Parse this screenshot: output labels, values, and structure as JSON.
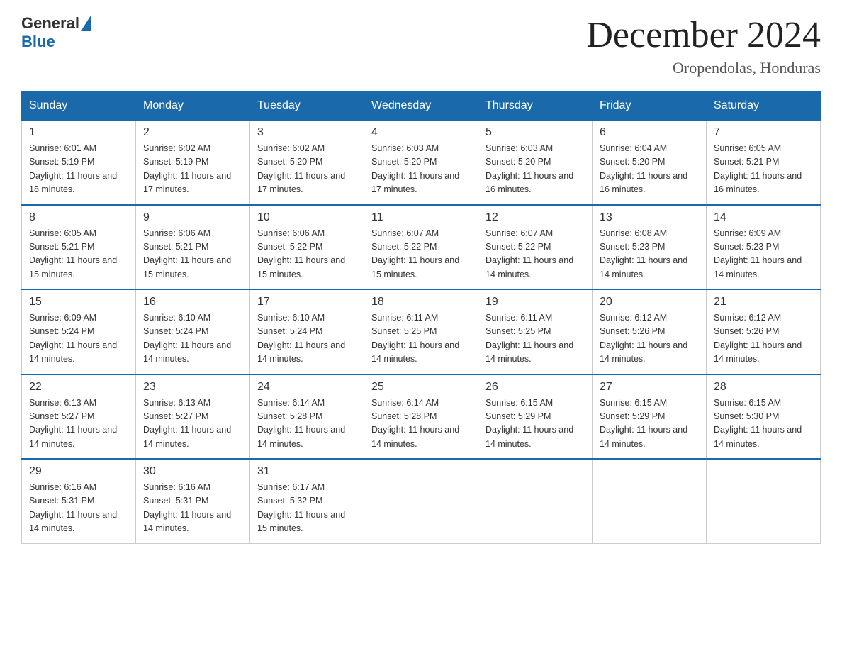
{
  "logo": {
    "text1": "General",
    "text2": "Blue"
  },
  "title": "December 2024",
  "location": "Oropendolas, Honduras",
  "days_header": [
    "Sunday",
    "Monday",
    "Tuesday",
    "Wednesday",
    "Thursday",
    "Friday",
    "Saturday"
  ],
  "weeks": [
    [
      {
        "day": "1",
        "sunrise": "6:01 AM",
        "sunset": "5:19 PM",
        "daylight": "11 hours and 18 minutes."
      },
      {
        "day": "2",
        "sunrise": "6:02 AM",
        "sunset": "5:19 PM",
        "daylight": "11 hours and 17 minutes."
      },
      {
        "day": "3",
        "sunrise": "6:02 AM",
        "sunset": "5:20 PM",
        "daylight": "11 hours and 17 minutes."
      },
      {
        "day": "4",
        "sunrise": "6:03 AM",
        "sunset": "5:20 PM",
        "daylight": "11 hours and 17 minutes."
      },
      {
        "day": "5",
        "sunrise": "6:03 AM",
        "sunset": "5:20 PM",
        "daylight": "11 hours and 16 minutes."
      },
      {
        "day": "6",
        "sunrise": "6:04 AM",
        "sunset": "5:20 PM",
        "daylight": "11 hours and 16 minutes."
      },
      {
        "day": "7",
        "sunrise": "6:05 AM",
        "sunset": "5:21 PM",
        "daylight": "11 hours and 16 minutes."
      }
    ],
    [
      {
        "day": "8",
        "sunrise": "6:05 AM",
        "sunset": "5:21 PM",
        "daylight": "11 hours and 15 minutes."
      },
      {
        "day": "9",
        "sunrise": "6:06 AM",
        "sunset": "5:21 PM",
        "daylight": "11 hours and 15 minutes."
      },
      {
        "day": "10",
        "sunrise": "6:06 AM",
        "sunset": "5:22 PM",
        "daylight": "11 hours and 15 minutes."
      },
      {
        "day": "11",
        "sunrise": "6:07 AM",
        "sunset": "5:22 PM",
        "daylight": "11 hours and 15 minutes."
      },
      {
        "day": "12",
        "sunrise": "6:07 AM",
        "sunset": "5:22 PM",
        "daylight": "11 hours and 14 minutes."
      },
      {
        "day": "13",
        "sunrise": "6:08 AM",
        "sunset": "5:23 PM",
        "daylight": "11 hours and 14 minutes."
      },
      {
        "day": "14",
        "sunrise": "6:09 AM",
        "sunset": "5:23 PM",
        "daylight": "11 hours and 14 minutes."
      }
    ],
    [
      {
        "day": "15",
        "sunrise": "6:09 AM",
        "sunset": "5:24 PM",
        "daylight": "11 hours and 14 minutes."
      },
      {
        "day": "16",
        "sunrise": "6:10 AM",
        "sunset": "5:24 PM",
        "daylight": "11 hours and 14 minutes."
      },
      {
        "day": "17",
        "sunrise": "6:10 AM",
        "sunset": "5:24 PM",
        "daylight": "11 hours and 14 minutes."
      },
      {
        "day": "18",
        "sunrise": "6:11 AM",
        "sunset": "5:25 PM",
        "daylight": "11 hours and 14 minutes."
      },
      {
        "day": "19",
        "sunrise": "6:11 AM",
        "sunset": "5:25 PM",
        "daylight": "11 hours and 14 minutes."
      },
      {
        "day": "20",
        "sunrise": "6:12 AM",
        "sunset": "5:26 PM",
        "daylight": "11 hours and 14 minutes."
      },
      {
        "day": "21",
        "sunrise": "6:12 AM",
        "sunset": "5:26 PM",
        "daylight": "11 hours and 14 minutes."
      }
    ],
    [
      {
        "day": "22",
        "sunrise": "6:13 AM",
        "sunset": "5:27 PM",
        "daylight": "11 hours and 14 minutes."
      },
      {
        "day": "23",
        "sunrise": "6:13 AM",
        "sunset": "5:27 PM",
        "daylight": "11 hours and 14 minutes."
      },
      {
        "day": "24",
        "sunrise": "6:14 AM",
        "sunset": "5:28 PM",
        "daylight": "11 hours and 14 minutes."
      },
      {
        "day": "25",
        "sunrise": "6:14 AM",
        "sunset": "5:28 PM",
        "daylight": "11 hours and 14 minutes."
      },
      {
        "day": "26",
        "sunrise": "6:15 AM",
        "sunset": "5:29 PM",
        "daylight": "11 hours and 14 minutes."
      },
      {
        "day": "27",
        "sunrise": "6:15 AM",
        "sunset": "5:29 PM",
        "daylight": "11 hours and 14 minutes."
      },
      {
        "day": "28",
        "sunrise": "6:15 AM",
        "sunset": "5:30 PM",
        "daylight": "11 hours and 14 minutes."
      }
    ],
    [
      {
        "day": "29",
        "sunrise": "6:16 AM",
        "sunset": "5:31 PM",
        "daylight": "11 hours and 14 minutes."
      },
      {
        "day": "30",
        "sunrise": "6:16 AM",
        "sunset": "5:31 PM",
        "daylight": "11 hours and 14 minutes."
      },
      {
        "day": "31",
        "sunrise": "6:17 AM",
        "sunset": "5:32 PM",
        "daylight": "11 hours and 15 minutes."
      },
      null,
      null,
      null,
      null
    ]
  ]
}
